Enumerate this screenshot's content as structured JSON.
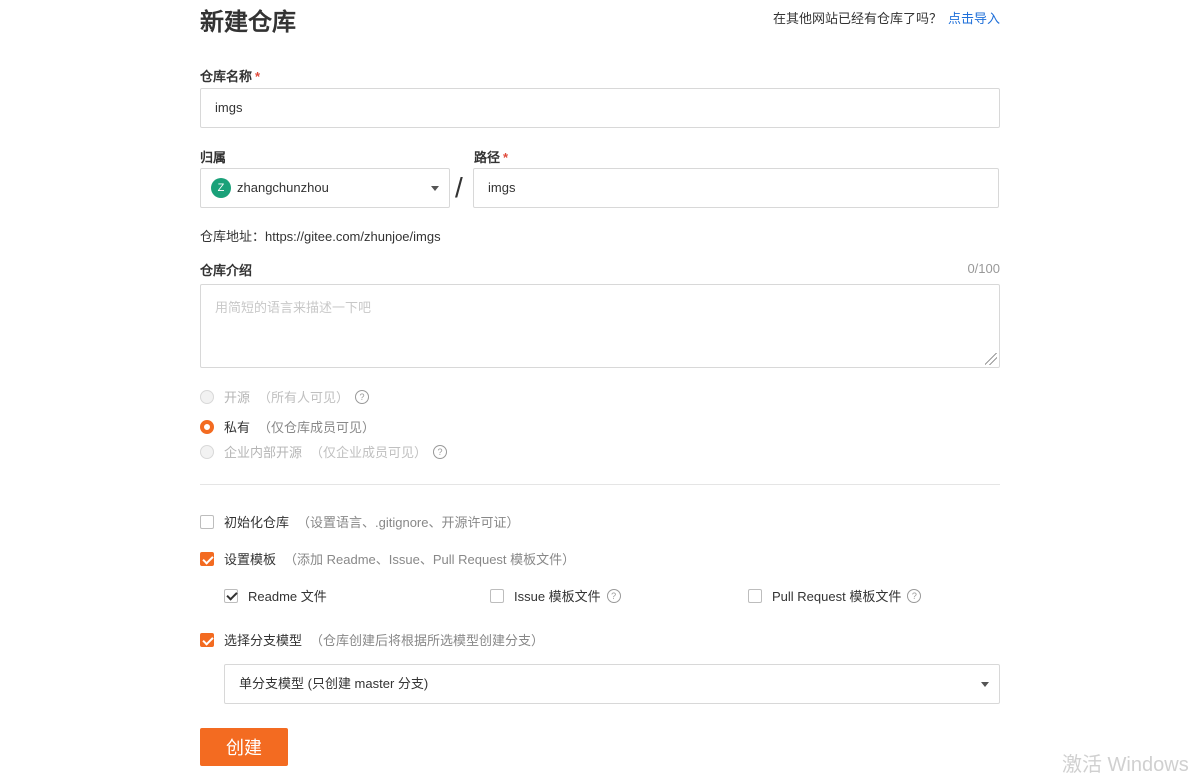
{
  "page": {
    "title": "新建仓库",
    "import_prompt": "在其他网站已经有仓库了吗？",
    "import_link": "点击导入"
  },
  "repo_name": {
    "label": "仓库名称",
    "required_mark": "*",
    "value": "imgs"
  },
  "owner": {
    "label": "归属",
    "avatar_letter": "Z",
    "value": "zhangchunzhou"
  },
  "path": {
    "label": "路径",
    "required_mark": "*",
    "separator": "/",
    "value": "imgs"
  },
  "address": {
    "text": "仓库地址：https://gitee.com/zhunjoe/imgs"
  },
  "description": {
    "label": "仓库介绍",
    "counter": "0/100",
    "placeholder": "用简短的语言来描述一下吧"
  },
  "visibility": [
    {
      "label": "开源",
      "hint": "（所有人可见）",
      "selected": false,
      "disabled": true
    },
    {
      "label": "私有",
      "hint": "（仅仓库成员可见）",
      "selected": true,
      "disabled": false
    },
    {
      "label": "企业内部开源",
      "hint": "（仅企业成员可见）",
      "selected": false,
      "disabled": true
    }
  ],
  "options": {
    "init": {
      "label": "初始化仓库",
      "hint": "（设置语言、.gitignore、开源许可证）",
      "checked": false
    },
    "template": {
      "label": "设置模板",
      "hint": "（添加 Readme、Issue、Pull Request 模板文件）",
      "checked": true
    },
    "templates": [
      {
        "label": "Readme 文件",
        "checked": true
      },
      {
        "label": "Issue 模板文件",
        "checked": false
      },
      {
        "label": "Pull Request 模板文件",
        "checked": false
      }
    ],
    "branch": {
      "label": "选择分支模型",
      "hint": "（仓库创建后将根据所选模型创建分支）",
      "checked": true
    },
    "branch_model": "单分支模型 (只创建 master 分支)"
  },
  "submit_label": "创建",
  "watermark": "激活 Windows",
  "colors": {
    "accent": "#f36b21",
    "link": "#1e6fd9",
    "avatar": "#1aa179"
  }
}
